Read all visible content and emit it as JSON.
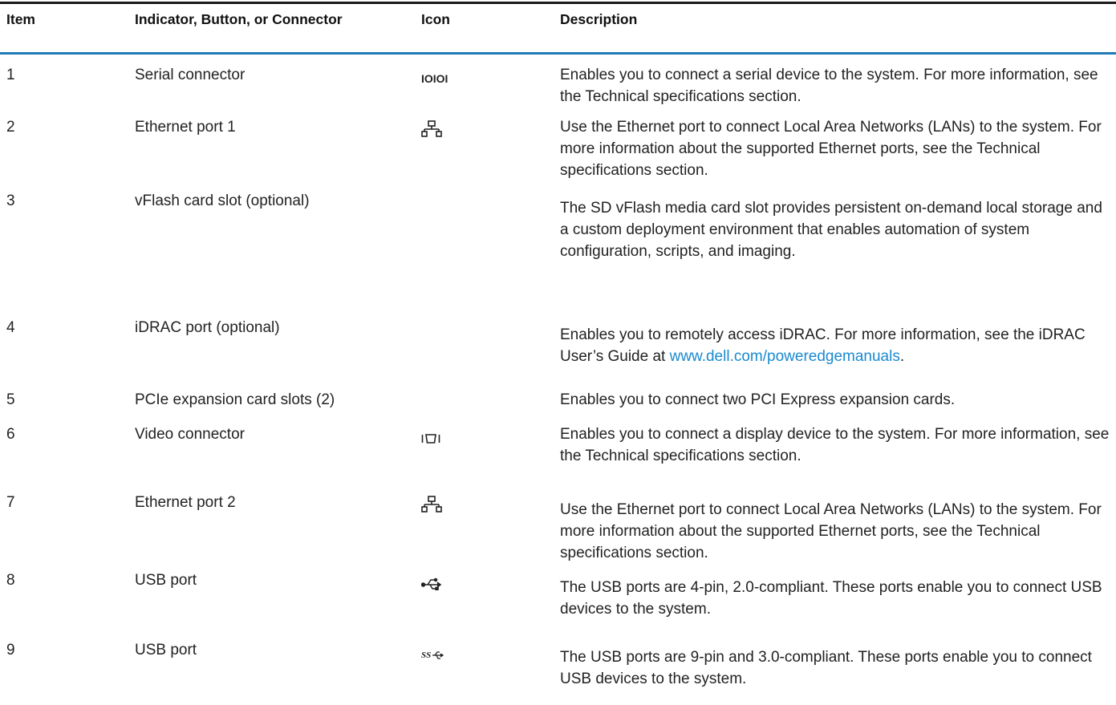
{
  "table": {
    "headers": {
      "item": "Item",
      "indicator": "Indicator, Button, or Connector",
      "icon": "Icon",
      "description": "Description"
    },
    "rows": [
      {
        "item": "1",
        "name": "Serial connector",
        "icon": "serial-icon",
        "description": "Enables you to connect a serial device to the system. For more information, see the Technical specifications section."
      },
      {
        "item": "2",
        "name": "Ethernet port 1",
        "icon": "ethernet-icon",
        "description": "Use the Ethernet port to connect Local Area Networks (LANs) to the system. For more information about the supported Ethernet ports, see the Technical specifications section."
      },
      {
        "item": "3",
        "name": "vFlash card slot (optional)",
        "icon": "",
        "description": "The SD vFlash media card slot provides persistent on-demand local storage and a custom deployment environment that enables automation of system configuration, scripts, and imaging."
      },
      {
        "item": "4",
        "name": "iDRAC port (optional)",
        "icon": "",
        "description_prefix": "Enables you to remotely access iDRAC. For more information, see the iDRAC User’s Guide at ",
        "description_link": "www.dell.com/poweredgemanuals",
        "description_suffix": "."
      },
      {
        "item": "5",
        "name": "PCIe expansion card slots (2)",
        "icon": "",
        "description": "Enables you to connect two PCI Express expansion cards."
      },
      {
        "item": "6",
        "name": "Video connector",
        "icon": "video-icon",
        "description": "Enables you to connect a display device to the system. For more information, see the Technical specifications section."
      },
      {
        "item": "7",
        "name": "Ethernet port 2",
        "icon": "ethernet-icon",
        "description": "Use the Ethernet port to connect Local Area Networks (LANs) to the system. For more information about the supported Ethernet ports, see the Technical specifications section."
      },
      {
        "item": "8",
        "name": "USB port",
        "icon": "usb-icon",
        "description": "The USB ports are 4-pin, 2.0-compliant. These ports enable you to connect USB devices to the system."
      },
      {
        "item": "9",
        "name": "USB port",
        "icon": "usb-ss-icon",
        "description": "The USB ports are 9-pin and 3.0-compliant. These ports enable you to connect USB devices to the system."
      }
    ]
  },
  "colors": {
    "header_rule": "#1f7bb6",
    "top_rule": "#1a1a1a",
    "link": "#1a8ad0"
  }
}
